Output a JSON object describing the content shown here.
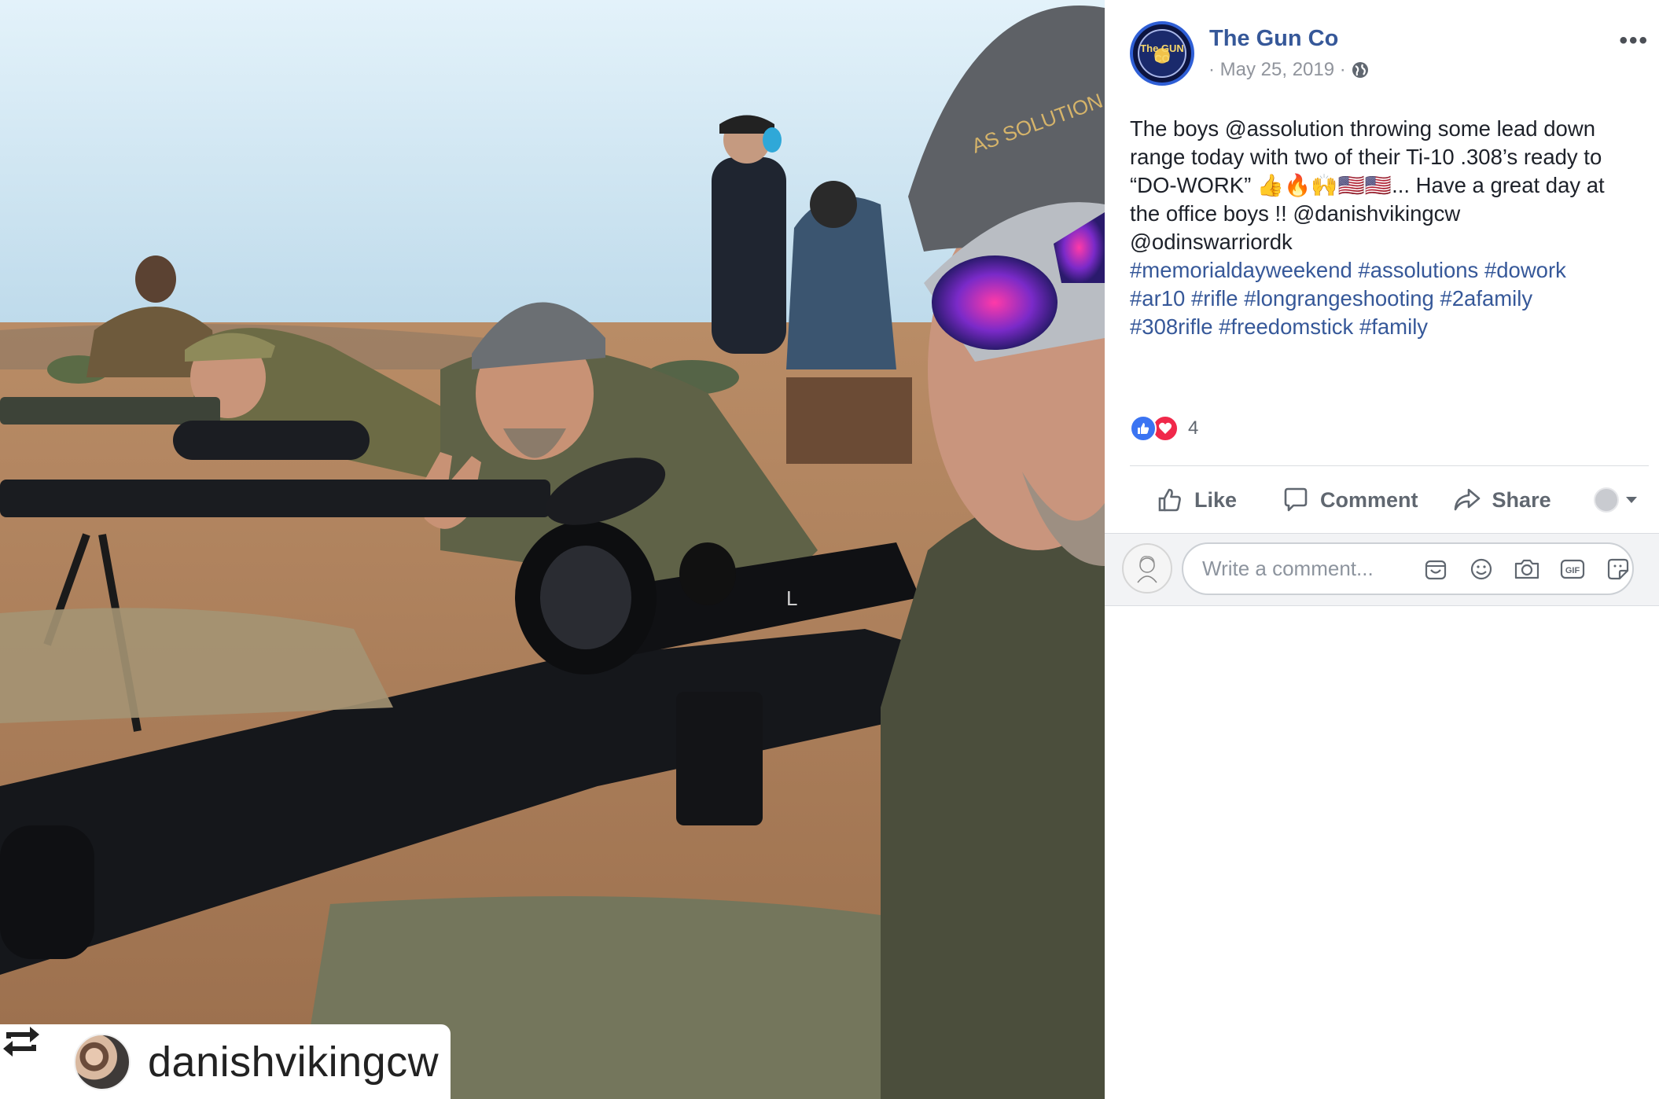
{
  "post": {
    "page_name": "The Gun Co",
    "date": "· May 25, 2019 ·",
    "more_label": "•••",
    "avatar_text": "The GUN CO",
    "caption_lines": [
      "The boys @assolution throwing some lead down",
      "range today with two of their Ti-10 .308’s ready to",
      "“DO-WORK” 👍🔥🙌🇺🇸🇺🇸... Have a great day at",
      "the office boys !! @danishvikingcw",
      "@odinswarriordk"
    ],
    "hashtag_lines": [
      "#memorialdayweekend #assolutions #dowork",
      "#ar10 #rifle #longrangeshooting #2afamily",
      "#308rifle #freedomstick #family"
    ],
    "reaction_count": "4",
    "reaction_icons": [
      "like-icon",
      "love-icon"
    ]
  },
  "actions": {
    "like": "Like",
    "comment": "Comment",
    "share": "Share"
  },
  "comment_box": {
    "placeholder": "Write a comment...",
    "tools": [
      "sticker-icon",
      "emoji-icon",
      "camera-icon",
      "gif-icon",
      "sticker-face-icon"
    ]
  },
  "photo": {
    "repost_username": "danishvikingcw",
    "hat_text": "AS SOLUTION",
    "scope_brand": "L"
  },
  "colors": {
    "link": "#365899",
    "muted": "#90949c",
    "action": "#606770",
    "like_blue": "#3b74f2",
    "love_red": "#f0284a"
  }
}
